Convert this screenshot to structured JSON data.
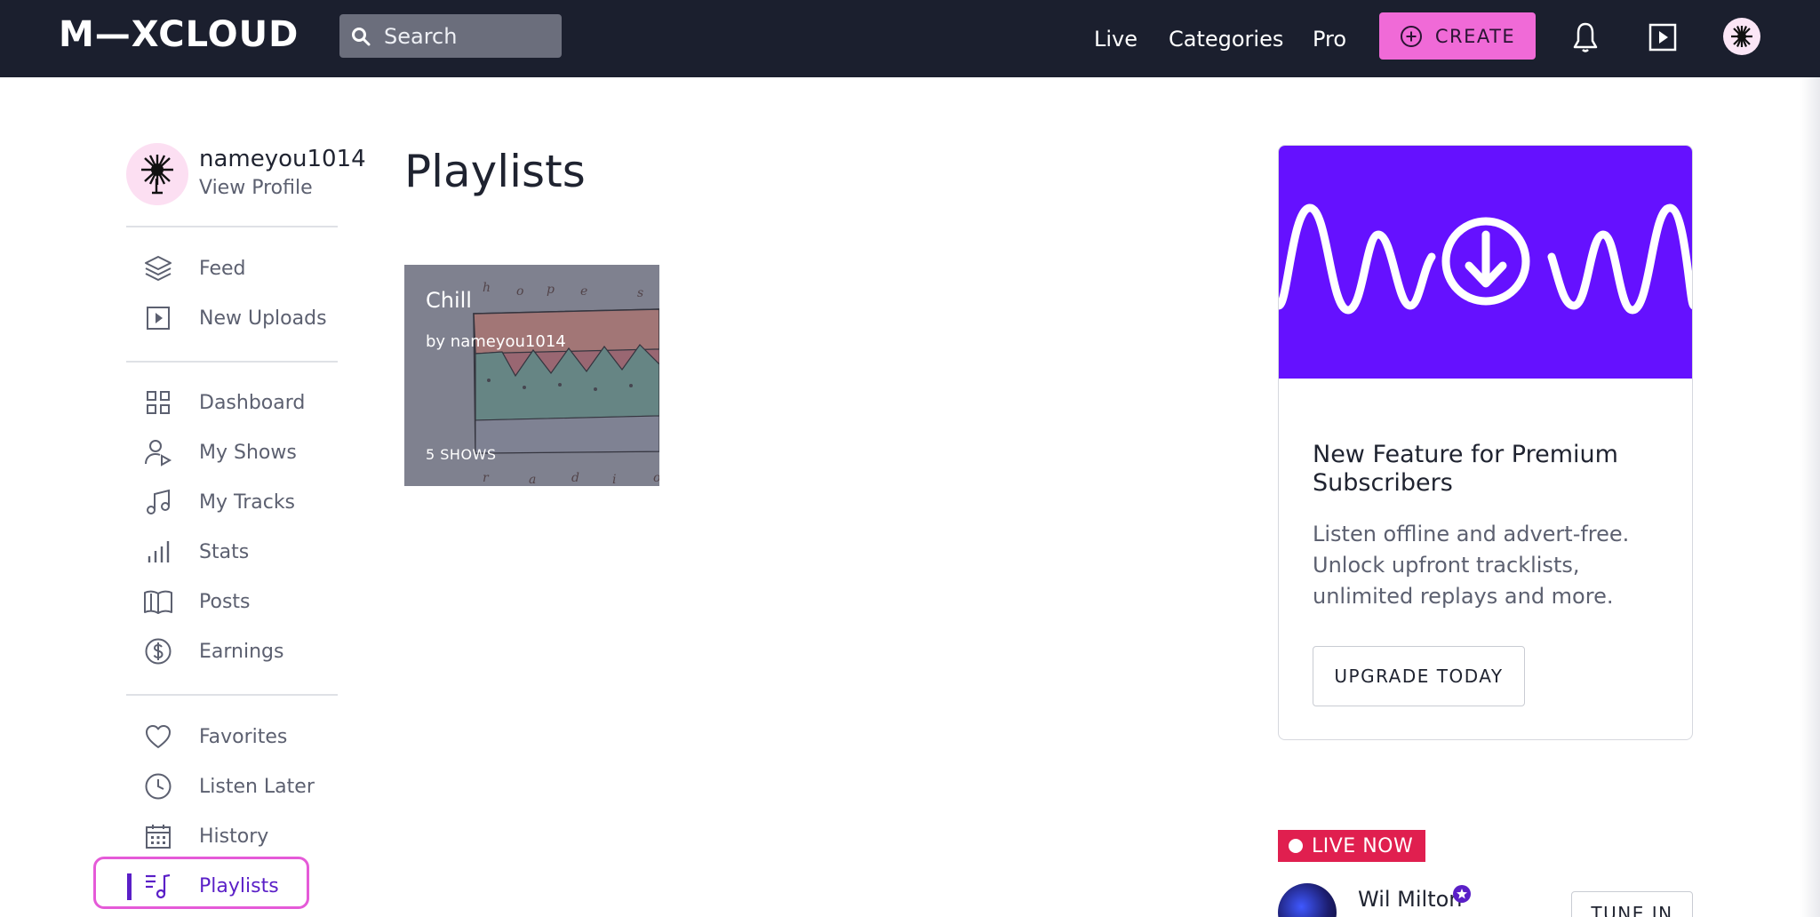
{
  "header": {
    "logo": "M—XCLOUD",
    "search": {
      "placeholder": "Search"
    },
    "nav": {
      "live": "Live",
      "categories": "Categories",
      "pro": "Pro"
    },
    "create_label": "CREATE"
  },
  "sidebar": {
    "username": "nameyou1014",
    "view_profile": "View Profile",
    "group1": [
      {
        "label": "Feed",
        "icon": "layers-icon"
      },
      {
        "label": "New Uploads",
        "icon": "play-square-icon"
      }
    ],
    "group2": [
      {
        "label": "Dashboard",
        "icon": "grid-icon"
      },
      {
        "label": "My Shows",
        "icon": "user-play-icon"
      },
      {
        "label": "My Tracks",
        "icon": "music-note-icon"
      },
      {
        "label": "Stats",
        "icon": "bar-chart-icon"
      },
      {
        "label": "Posts",
        "icon": "book-icon"
      },
      {
        "label": "Earnings",
        "icon": "dollar-circle-icon"
      }
    ],
    "group3": [
      {
        "label": "Favorites",
        "icon": "heart-icon"
      },
      {
        "label": "Listen Later",
        "icon": "clock-icon"
      },
      {
        "label": "History",
        "icon": "calendar-icon"
      },
      {
        "label": "Playlists",
        "icon": "playlist-icon",
        "active": true
      }
    ]
  },
  "main": {
    "title": "Playlists",
    "playlists": [
      {
        "title": "Chill",
        "by": "by nameyou1014",
        "count": "5 SHOWS"
      }
    ]
  },
  "promo": {
    "title": "New Feature for Premium Subscribers",
    "body": "Listen offline and advert-free. Unlock upfront tracklists, unlimited replays and more.",
    "button": "UPGRADE TODAY"
  },
  "live": {
    "badge": "LIVE NOW",
    "name": "Wil Milton",
    "button": "TUNE IN"
  },
  "colors": {
    "topbar": "#1b1f2e",
    "accent_pink": "#f06ad7",
    "accent_purple": "#5a1fc7",
    "promo_banner": "#6511ff",
    "live_red": "#e01f4f"
  }
}
